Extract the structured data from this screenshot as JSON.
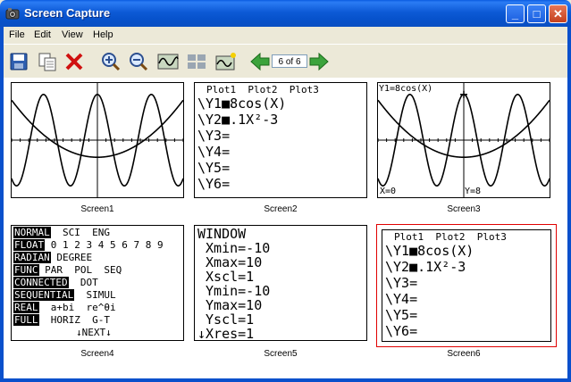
{
  "window": {
    "title": "Screen Capture",
    "minimize": "_",
    "maximize": "□",
    "close": "✕"
  },
  "menu": [
    "File",
    "Edit",
    "View",
    "Help"
  ],
  "toolbar": {
    "page_indicator": "6 of 6"
  },
  "screens": [
    {
      "caption": "Screen1"
    },
    {
      "caption": "Screen2",
      "header": "Plot1  Plot2  Plot3",
      "lines": [
        "\\Y1■8cos(X)",
        "\\Y2■.1X²-3",
        "\\Y3=",
        "\\Y4=",
        "\\Y5=",
        "\\Y6="
      ]
    },
    {
      "caption": "Screen3",
      "top_label": "Y1=8cos(X)",
      "x_label": "X=0",
      "y_label": "Y=8"
    },
    {
      "caption": "Screen4",
      "rows": [
        [
          "NORMAL",
          "SCI",
          "ENG"
        ],
        [
          "FLOAT",
          "0 1 2 3 4 5 6 7 8 9"
        ],
        [
          "RADIAN",
          "DEGREE"
        ],
        [
          "FUNC",
          "PAR",
          "POL",
          "SEQ"
        ],
        [
          "CONNECTED",
          "DOT"
        ],
        [
          "SEQUENTIAL",
          "SIMUL"
        ],
        [
          "REAL",
          "a+bi",
          "re^θi"
        ],
        [
          "FULL",
          "HORIZ",
          "G-T"
        ],
        [
          "↓NEXT↓"
        ]
      ]
    },
    {
      "caption": "Screen5",
      "lines": [
        "WINDOW",
        " Xmin=-10",
        " Xmax=10",
        " Xscl=1",
        " Ymin=-10",
        " Ymax=10",
        " Yscl=1",
        "↓Xres=1"
      ]
    },
    {
      "caption": "Screen6",
      "header": "Plot1  Plot2  Plot3",
      "lines": [
        "\\Y1■8cos(X)",
        "\\Y2■.1X²-3",
        "\\Y3=",
        "\\Y4=",
        "\\Y5=",
        "\\Y6="
      ]
    }
  ]
}
